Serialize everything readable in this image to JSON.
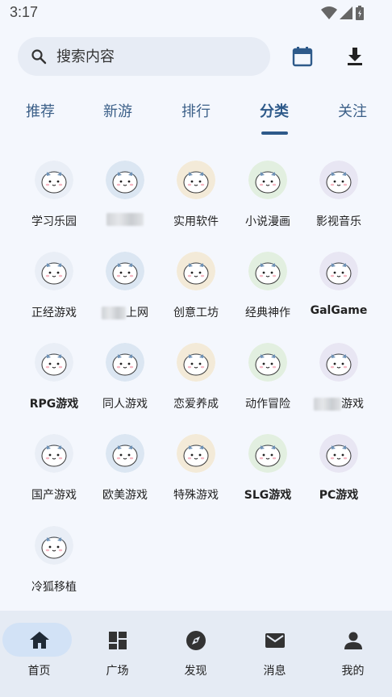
{
  "status_bar": {
    "time": "3:17"
  },
  "search": {
    "placeholder": "搜索内容"
  },
  "tabs": [
    {
      "label": "推荐",
      "active": false
    },
    {
      "label": "新游",
      "active": false
    },
    {
      "label": "排行",
      "active": false
    },
    {
      "label": "分类",
      "active": true
    },
    {
      "label": "关注",
      "active": false
    }
  ],
  "categories": [
    {
      "label": "学习乐园"
    },
    {
      "label": ""
    },
    {
      "label": "实用软件"
    },
    {
      "label": "小说漫画"
    },
    {
      "label": "影视音乐"
    },
    {
      "label": "正经游戏"
    },
    {
      "label": "上网"
    },
    {
      "label": "创意工坊"
    },
    {
      "label": "经典神作"
    },
    {
      "label": "GalGame"
    },
    {
      "label": "RPG游戏"
    },
    {
      "label": "同人游戏"
    },
    {
      "label": "恋爱养成"
    },
    {
      "label": "动作冒险"
    },
    {
      "label": "游戏"
    },
    {
      "label": "国产游戏"
    },
    {
      "label": "欧美游戏"
    },
    {
      "label": "特殊游戏"
    },
    {
      "label": "SLG游戏"
    },
    {
      "label": "PC游戏"
    },
    {
      "label": "冷狐移植"
    }
  ],
  "bottom_nav": [
    {
      "label": "首页",
      "icon": "home-icon",
      "active": true
    },
    {
      "label": "广场",
      "icon": "dashboard-icon",
      "active": false
    },
    {
      "label": "发现",
      "icon": "compass-icon",
      "active": false
    },
    {
      "label": "消息",
      "icon": "mail-icon",
      "active": false
    },
    {
      "label": "我的",
      "icon": "person-icon",
      "active": false
    }
  ],
  "colors": {
    "accent": "#2e5a8a",
    "background": "#f4f7fd",
    "nav_background": "#e5ebf4",
    "nav_active_pill": "#d2e2f6"
  }
}
